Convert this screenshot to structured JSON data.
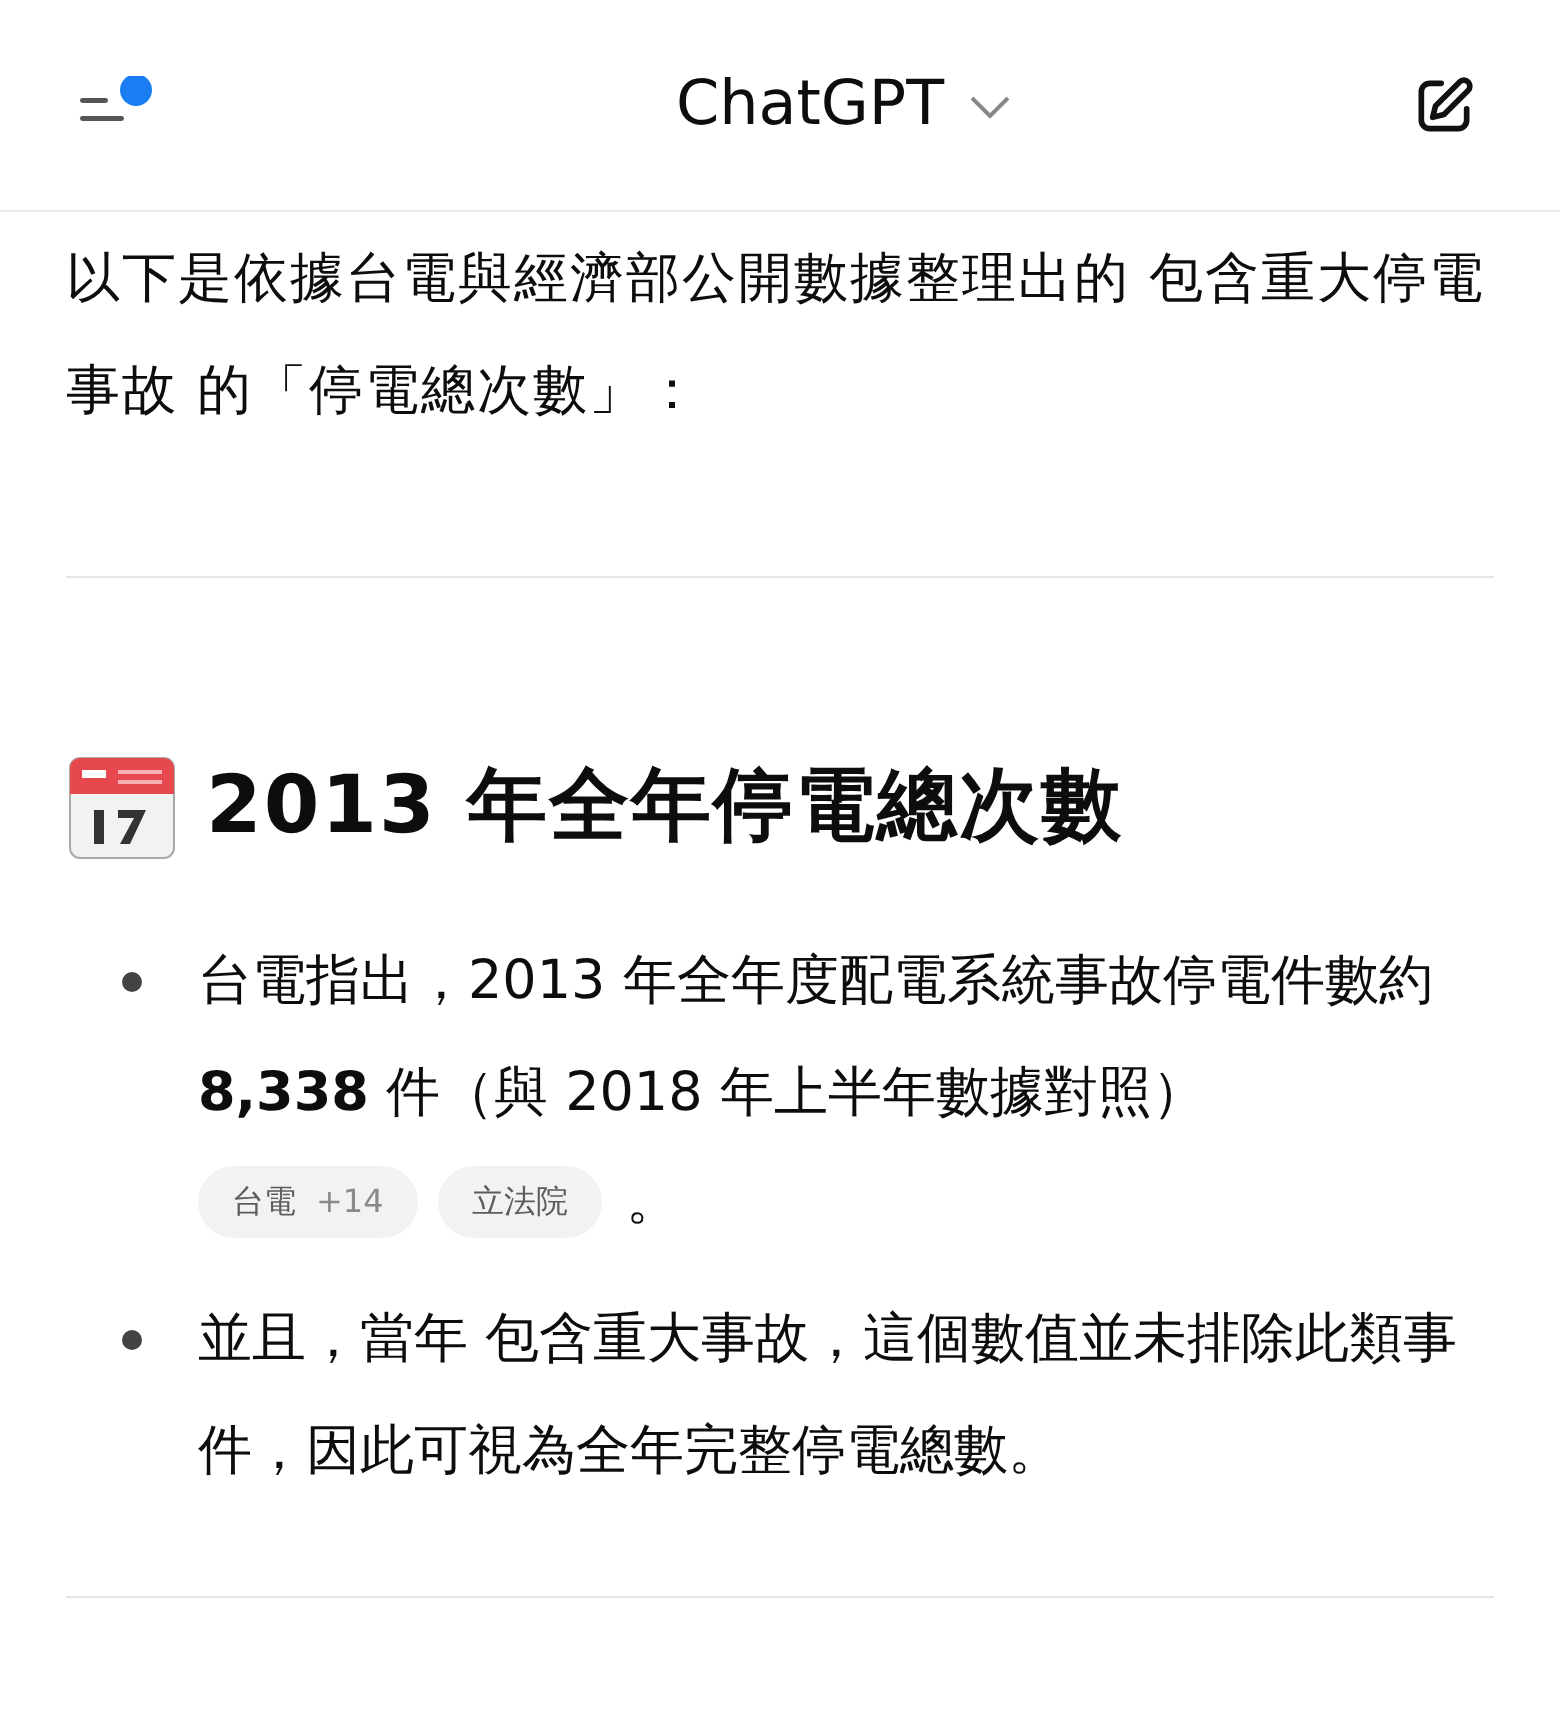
{
  "header": {
    "title": "ChatGPT",
    "notification": true
  },
  "intro": "以下是依據台電與經濟部公開數據整理出的 包含重大停電事故 的「停電總次數」：",
  "section": {
    "title": "2013 年全年停電總次數",
    "bullets": [
      {
        "text": "台電指出，2013 年全年度配電系統事故停電件數約 **8,338** 件（與 2018 年上半年數據對照）",
        "citations": [
          {
            "label": "台電",
            "count": "+14"
          },
          {
            "label": "立法院"
          }
        ],
        "after": "。"
      },
      {
        "text": "並且，當年 包含重大事故，這個數值並未排除此類事件，因此可視為全年完整停電總數。"
      }
    ]
  }
}
